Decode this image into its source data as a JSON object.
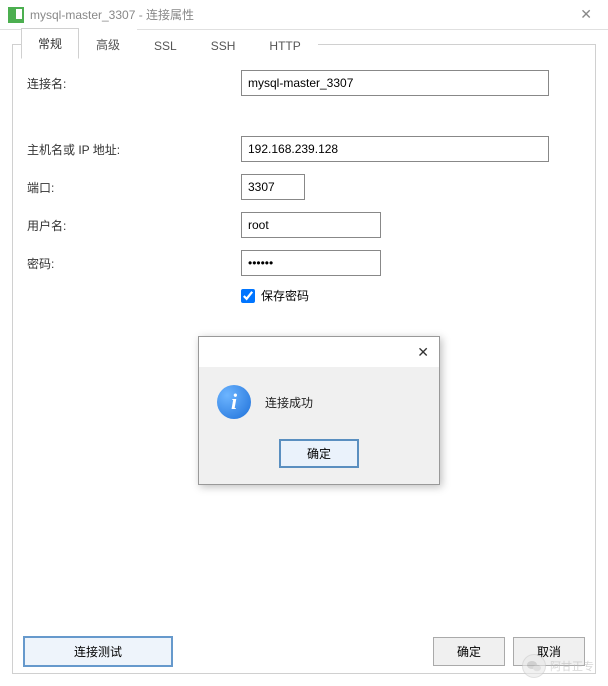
{
  "window": {
    "title": "mysql-master_3307 - 连接属性"
  },
  "tabs": [
    {
      "label": "常规",
      "active": true
    },
    {
      "label": "高级",
      "active": false
    },
    {
      "label": "SSL",
      "active": false
    },
    {
      "label": "SSH",
      "active": false
    },
    {
      "label": "HTTP",
      "active": false
    }
  ],
  "form": {
    "connection_name_label": "连接名:",
    "connection_name_value": "mysql-master_3307",
    "host_label": "主机名或 IP 地址:",
    "host_value": "192.168.239.128",
    "port_label": "端口:",
    "port_value": "3307",
    "username_label": "用户名:",
    "username_value": "root",
    "password_label": "密码:",
    "password_value": "••••••",
    "save_password_label": "保存密码",
    "save_password_checked": true
  },
  "buttons": {
    "test": "连接测试",
    "ok": "确定",
    "cancel": "取消"
  },
  "modal": {
    "message": "连接成功",
    "ok": "确定"
  },
  "watermark": {
    "text": "阿甘正专"
  }
}
